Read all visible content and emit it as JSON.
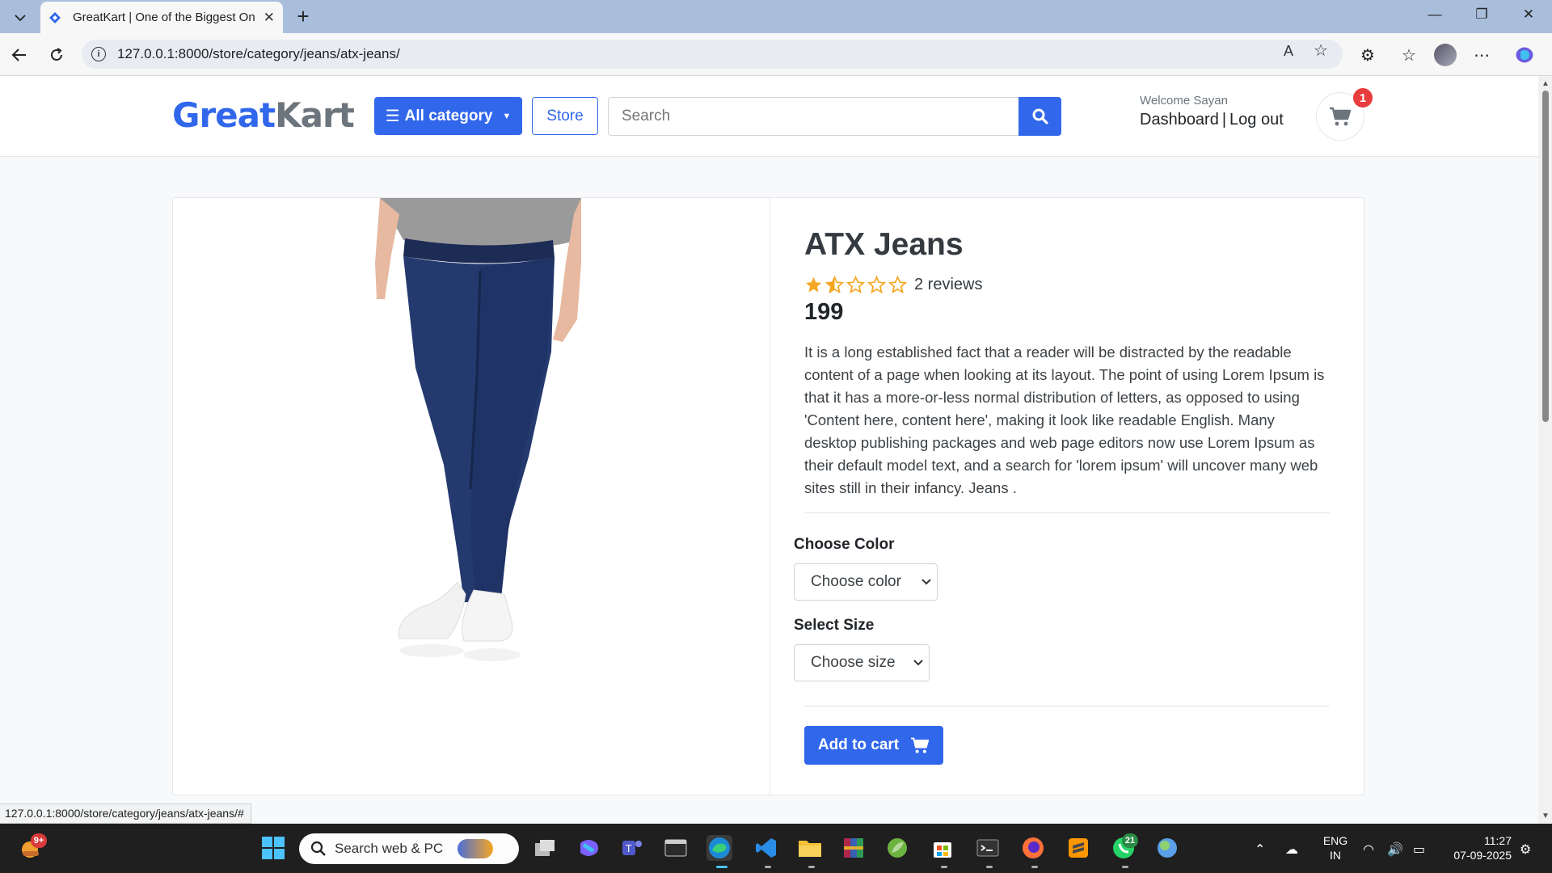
{
  "browser": {
    "tab_title": "GreatKart | One of the Biggest On",
    "tab_close": "✕",
    "new_tab": "+",
    "url": "127.0.0.1:8000/store/category/jeans/atx-jeans/",
    "status_url": "127.0.0.1:8000/store/category/jeans/atx-jeans/#",
    "window_controls": {
      "minimize": "—",
      "maximize": "❐",
      "close": "✕"
    }
  },
  "header": {
    "logo_part1": "Great",
    "logo_part2": "Kart",
    "category_button": "All category",
    "store_button": "Store",
    "search_placeholder": "Search",
    "welcome": "Welcome Sayan",
    "dashboard_link": "Dashboard",
    "separator": "|",
    "logout_link": "Log out",
    "cart_count": "1"
  },
  "product": {
    "title": "ATX Jeans",
    "rating": 1.5,
    "rating_max": 5,
    "reviews": "2 reviews",
    "price": "199",
    "description": "It is a long established fact that a reader will be distracted by the readable content of a page when looking at its layout. The point of using Lorem Ipsum is that it has a more-or-less normal distribution of letters, as opposed to using 'Content here, content here', making it look like readable English. Many desktop publishing packages and web page editors now use Lorem Ipsum as their default model text, and a search for 'lorem ipsum' will uncover many web sites still in their infancy. Jeans .",
    "color_label": "Choose Color",
    "color_select": "Choose color",
    "size_label": "Select Size",
    "size_select": "Choose size",
    "add_to_cart": "Add to cart"
  },
  "colors": {
    "brand": "#3167eb",
    "star": "#f5a623",
    "badge": "#e93c3c"
  },
  "taskbar": {
    "weather_badge": "9+",
    "search_text": "Search web & PC",
    "whatsapp_badge": "21",
    "lang_top": "ENG",
    "lang_bottom": "IN",
    "time": "11:27",
    "date": "07-09-2025"
  }
}
